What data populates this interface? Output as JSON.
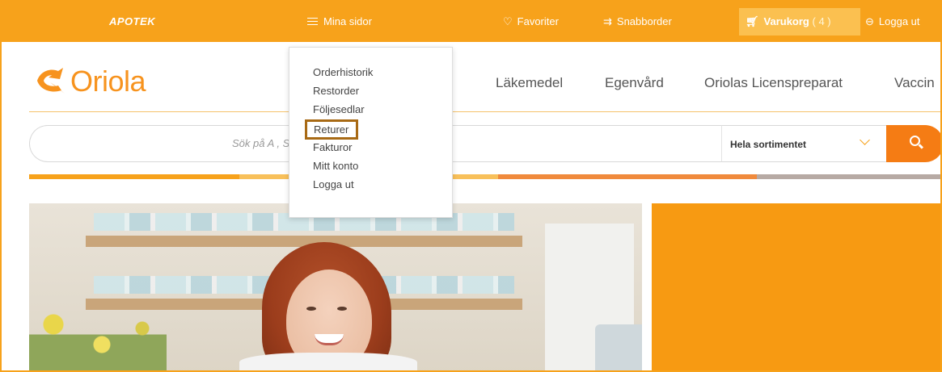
{
  "topbar": {
    "apotek": "APOTEK",
    "mina_sidor": "Mina sidor",
    "favoriter": "Favoriter",
    "snabborder": "Snabborder",
    "varukorg": "Varukorg",
    "varukorg_count": "( 4 )",
    "logga_ut": "Logga ut"
  },
  "logo": {
    "text": "Oriola"
  },
  "mainnav": [
    "Läkemedel",
    "Egenvård",
    "Oriolas Licenspreparat",
    "Vaccin"
  ],
  "search": {
    "placeholder": "Sök på A                                          , Substans, EAN-kod eller Varumärke",
    "scope": "Hela sortimentet"
  },
  "dropdown": {
    "items": [
      "Orderhistorik",
      "Restorder",
      "Följesedlar",
      "Returer",
      "Fakturor",
      "Mitt konto",
      "Logga ut"
    ],
    "selected": "Returer"
  },
  "colors": {
    "brand_orange": "#f7a21b",
    "search_button": "#f57c14",
    "hero_panel": "#f79a12",
    "highlight_border": "#a86a15"
  },
  "icons": [
    "menu-icon",
    "heart-icon",
    "eye-icon",
    "cart-icon",
    "logout-icon",
    "search-icon",
    "chevron-down-icon"
  ]
}
